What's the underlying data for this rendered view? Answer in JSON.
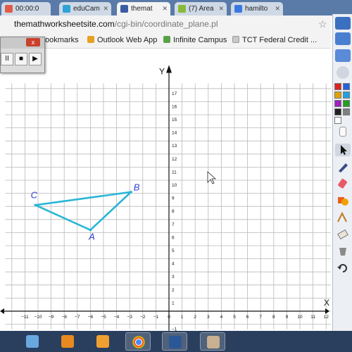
{
  "browser": {
    "tabs": [
      {
        "label": "00:00:0",
        "color": "#e25b4a",
        "active": false
      },
      {
        "label": "eduCam",
        "color": "#2ea3d6",
        "active": false
      },
      {
        "label": "themat",
        "color": "#3b5ba5",
        "active": true
      },
      {
        "label": "(7) Area",
        "color": "#8ab83a",
        "active": false
      },
      {
        "label": "hamilto",
        "color": "#3a78e0",
        "active": false
      }
    ],
    "url_host": "themathworksheetsite.com",
    "url_path": "/cgi-bin/coordinate_plane.pl",
    "bookmarks": [
      {
        "label": "ookmarks",
        "color": "#d2a23a"
      },
      {
        "label": "Outlook Web App",
        "color": "#e8a020"
      },
      {
        "label": "Infinite Campus",
        "color": "#5aa04a"
      },
      {
        "label": "TCT Federal Credit ...",
        "color": "#c0c0c0"
      }
    ]
  },
  "recorder": {
    "close_label": "x",
    "pause_label": "II",
    "stop_label": "■",
    "play_label": "▶"
  },
  "chart_data": {
    "type": "scatter",
    "title": "",
    "xlabel": "X",
    "ylabel": "Y",
    "xlim": [
      -12,
      12
    ],
    "ylim": [
      -1,
      17
    ],
    "x_ticks": [
      -11,
      -10,
      -9,
      -8,
      -7,
      -6,
      -5,
      -4,
      -3,
      -2,
      -1,
      0,
      1,
      2,
      3,
      4,
      5,
      6,
      7,
      8,
      9,
      10,
      11,
      12
    ],
    "y_ticks": [
      -1,
      1,
      2,
      3,
      4,
      5,
      6,
      7,
      8,
      9,
      10,
      11,
      12,
      13,
      14,
      15,
      16,
      17
    ],
    "grid": true,
    "series": [
      {
        "points": [
          {
            "label": "A",
            "x": -6,
            "y": 6.2
          },
          {
            "label": "B",
            "x": -2.9,
            "y": 9.1
          },
          {
            "label": "C",
            "x": -10.2,
            "y": 8.1
          }
        ],
        "closed": true,
        "color": "#29b6d6"
      }
    ],
    "annotation_color": "#2b3fd1"
  },
  "toolbar_colors": [
    "#e02020",
    "#2060e0",
    "#e0a000",
    "#20a0e0",
    "#a020c0",
    "#20a020",
    "#202020",
    "#808080",
    "#ffffff"
  ],
  "taskbar_apps": [
    "media-player-icon",
    "outlook-icon",
    "chrome-icon",
    "word-icon",
    "paint-icon"
  ]
}
